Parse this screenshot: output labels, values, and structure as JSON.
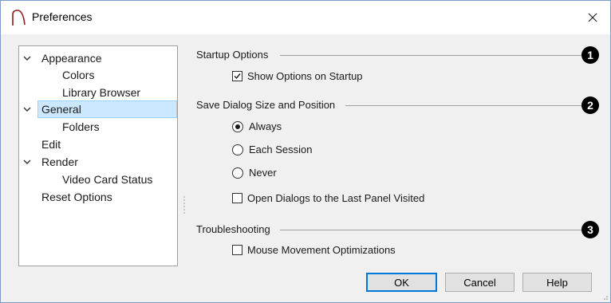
{
  "window": {
    "title": "Preferences",
    "close_glyph": "×"
  },
  "tree": {
    "items": [
      {
        "label": "Appearance",
        "expanded": true
      },
      {
        "label": "Colors"
      },
      {
        "label": "Library Browser"
      },
      {
        "label": "General",
        "expanded": true,
        "selected": true
      },
      {
        "label": "Folders"
      },
      {
        "label": "Edit"
      },
      {
        "label": "Render",
        "expanded": true
      },
      {
        "label": "Video Card Status"
      },
      {
        "label": "Reset Options"
      }
    ]
  },
  "groups": {
    "startup": {
      "title": "Startup Options",
      "badge": "1",
      "show_options": {
        "label": "Show Options on Startup",
        "checked": true
      }
    },
    "save_dialog": {
      "title": "Save Dialog Size and Position",
      "badge": "2",
      "radios": [
        {
          "label": "Always",
          "selected": true
        },
        {
          "label": "Each Session",
          "selected": false
        },
        {
          "label": "Never",
          "selected": false
        }
      ],
      "open_last_panel": {
        "label": "Open Dialogs to the Last Panel Visited",
        "checked": false
      }
    },
    "troubleshooting": {
      "title": "Troubleshooting",
      "badge": "3",
      "mouse_opt": {
        "label": "Mouse Movement Optimizations",
        "checked": false
      }
    }
  },
  "buttons": {
    "ok": "OK",
    "cancel": "Cancel",
    "help": "Help"
  },
  "colors": {
    "selection": "#cce8ff",
    "default_button_border": "#0078d7"
  }
}
